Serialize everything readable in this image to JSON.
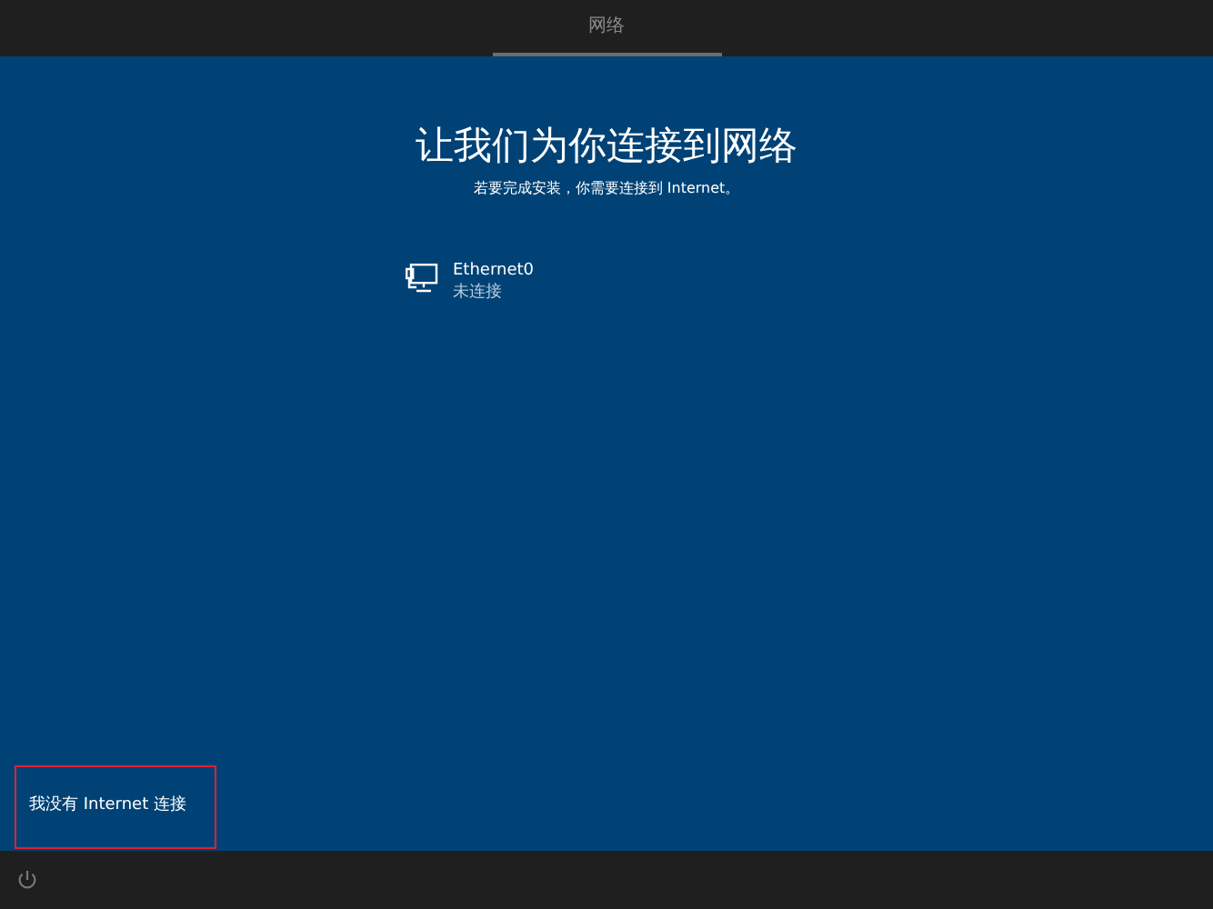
{
  "header": {
    "tabs": [
      {
        "label": "网络",
        "selected": true
      }
    ]
  },
  "title": "让我们为你连接到网络",
  "subtitle": "若要完成安装，你需要连接到 Internet。",
  "networks": [
    {
      "name": "Ethernet0",
      "status": "未连接"
    }
  ],
  "skip_link": {
    "label": "我没有 Internet 连接",
    "highlighted": true
  }
}
